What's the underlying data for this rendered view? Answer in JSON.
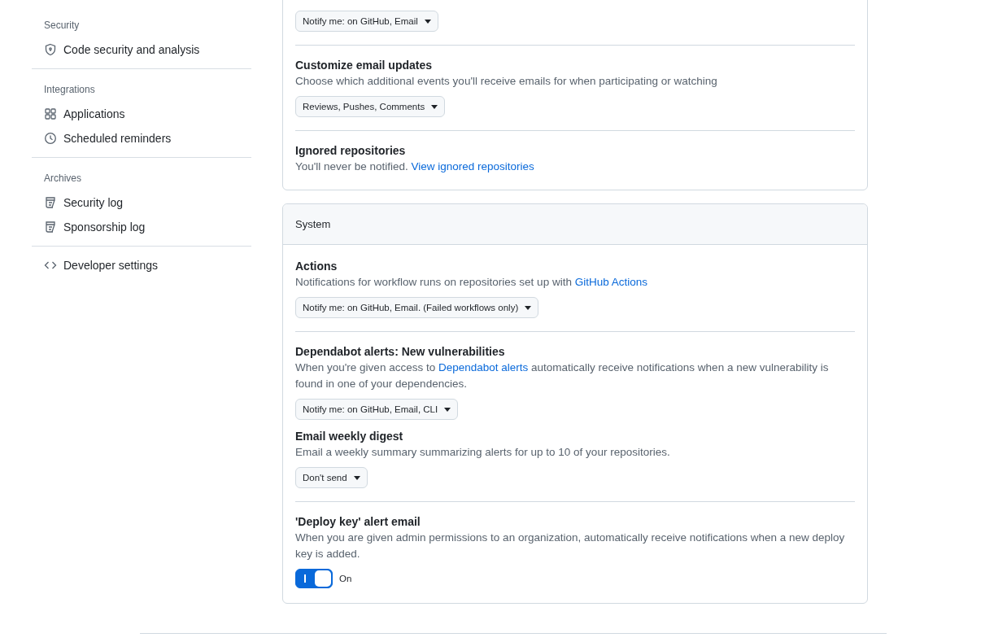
{
  "sidebar": {
    "sections": [
      {
        "heading": "Security",
        "items": [
          {
            "label": "Code security and analysis",
            "kind": "shield"
          }
        ]
      },
      {
        "heading": "Integrations",
        "items": [
          {
            "label": "Applications",
            "kind": "grid"
          },
          {
            "label": "Scheduled reminders",
            "kind": "clock"
          }
        ]
      },
      {
        "heading": "Archives",
        "items": [
          {
            "label": "Security log",
            "kind": "log"
          },
          {
            "label": "Sponsorship log",
            "kind": "log"
          }
        ]
      },
      {
        "items": [
          {
            "label": "Developer settings",
            "kind": "code"
          }
        ]
      }
    ]
  },
  "cards": [
    {
      "items": [
        {
          "divider": false,
          "dropdown": "Notify me: on GitHub, Email"
        },
        {
          "divider": true,
          "title": "Customize email updates",
          "description": "Choose which additional events you'll receive emails for when participating or watching",
          "dropdown": "Reviews, Pushes, Comments"
        },
        {
          "divider": true,
          "title": "Ignored repositories",
          "description": "You'll never be notified.",
          "link": "View ignored repositories"
        }
      ]
    },
    {
      "title": "System",
      "items": [
        {
          "title": "Actions",
          "description": "Notifications for workflow runs on repositories set up with",
          "link": "GitHub Actions",
          "dropdown": "Notify me: on GitHub, Email. (Failed workflows only)"
        },
        {
          "divider": true,
          "title": "Dependabot alerts: New vulnerabilities",
          "description": "When you're given access to",
          "link": "Dependabot alerts",
          "description_after": "automatically receive notifications when a new vulnerability is found in one of your dependencies.",
          "dropdown": "Notify me: on GitHub, Email, CLI"
        },
        {
          "divider": false,
          "title": "Email weekly digest",
          "description": "Email a weekly summary summarizing alerts for up to 10 of your repositories.",
          "dropdown": "Don't send"
        },
        {
          "divider": true,
          "title": "'Deploy key' alert email",
          "description": "When you are given admin permissions to an organization, automatically receive notifications when a new deploy key is added.",
          "toggle": {
            "on": true,
            "label": "On"
          }
        }
      ]
    }
  ]
}
